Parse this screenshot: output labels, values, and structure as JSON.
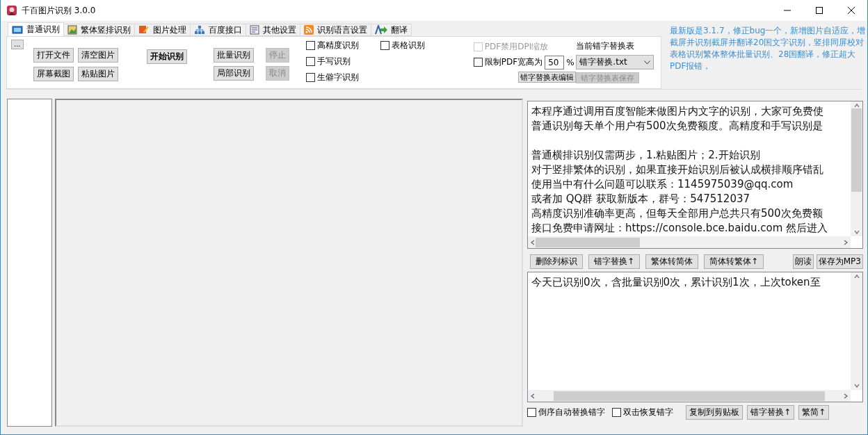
{
  "window": {
    "title": "千百图片识别 3.0.0"
  },
  "tabs": [
    {
      "label": "普通识别",
      "selected": true
    },
    {
      "label": "繁体竖排识别",
      "selected": false
    },
    {
      "label": "图片处理",
      "selected": false
    },
    {
      "label": "百度接口",
      "selected": false
    },
    {
      "label": "其他设置",
      "selected": false
    },
    {
      "label": "识别语言设置",
      "selected": false
    },
    {
      "label": "翻译",
      "selected": false
    }
  ],
  "toolbar": {
    "more_button": "...",
    "file_buttons": [
      [
        "打开文件",
        "屏幕截图"
      ],
      [
        "清空图片",
        "粘贴图片"
      ]
    ],
    "start_button": "开始识别",
    "batch_buttons": [
      [
        {
          "label": "批量识别",
          "disabled": false
        },
        {
          "label": "局部识别",
          "disabled": false
        }
      ],
      [
        {
          "label": "停止",
          "disabled": true
        },
        {
          "label": "取消",
          "disabled": true
        }
      ]
    ],
    "options": [
      [
        {
          "label": "高精度识别",
          "checked": false
        },
        {
          "label": "手写识别",
          "checked": false
        },
        {
          "label": "生僻字识别",
          "checked": false
        }
      ],
      [
        {
          "label": "表格识别",
          "checked": false
        }
      ]
    ],
    "pdf_dpi": {
      "label": "PDF禁用DPI缩放",
      "checked": false,
      "disabled": true
    },
    "pdf_limit": {
      "label": "限制PDF宽高为",
      "checked": false,
      "value": "50",
      "unit": "%"
    },
    "replace_table": {
      "label": "当前错字替换表",
      "value": "错字替换.txt",
      "edit_button": {
        "label": "错字替换表编辑",
        "disabled": false
      },
      "save_button": {
        "label": "错字替换表保存",
        "disabled": true
      }
    }
  },
  "update_note": "最新版是3.1.7，修正bug一个，新增图片自适应，增截屏并识别截屏并翻译20国文字识别，竖排同屏校对表格识别繁体整体批量识别、28国翻译，修正超大PDF报错，",
  "result_text": [
    [
      "本程序通过调用百度智能来做图片内文字的识别，大家可免费使",
      "普通识别每天单个用户有500次免费额度。高精度和手写识别是"
    ],
    [
      "普通横排识别仅需两步，1.粘贴图片；2.开始识别",
      "对于竖排繁体的识别，如果直接开始识别后被认成横排顺序错乱",
      "使用当中有什么问题可以联系：1145975039@qq.com",
      "或者加 QQ群 获取新版本，群号：547512037",
      "高精度识别准确率更高，但每天全部用户总共只有500次免费额",
      "接口免费申请网址：https://console.bce.baidu.com  然后进入"
    ]
  ],
  "text_buttons": [
    "删除列标识",
    "错字替换↑",
    "繁体转简体",
    "简体转繁体↑"
  ],
  "speech_buttons": [
    "朗读",
    "保存为MP3"
  ],
  "status_text": "今天已识别0次，含批量识别0次，累计识别1次，上次token至",
  "bottom_options": [
    {
      "label": "倒序自动替换错字",
      "checked": false
    },
    {
      "label": "双击恢复错字",
      "checked": false
    }
  ],
  "bottom_buttons": [
    "复制到剪贴板",
    "错字替换↑",
    "繁简↑"
  ]
}
